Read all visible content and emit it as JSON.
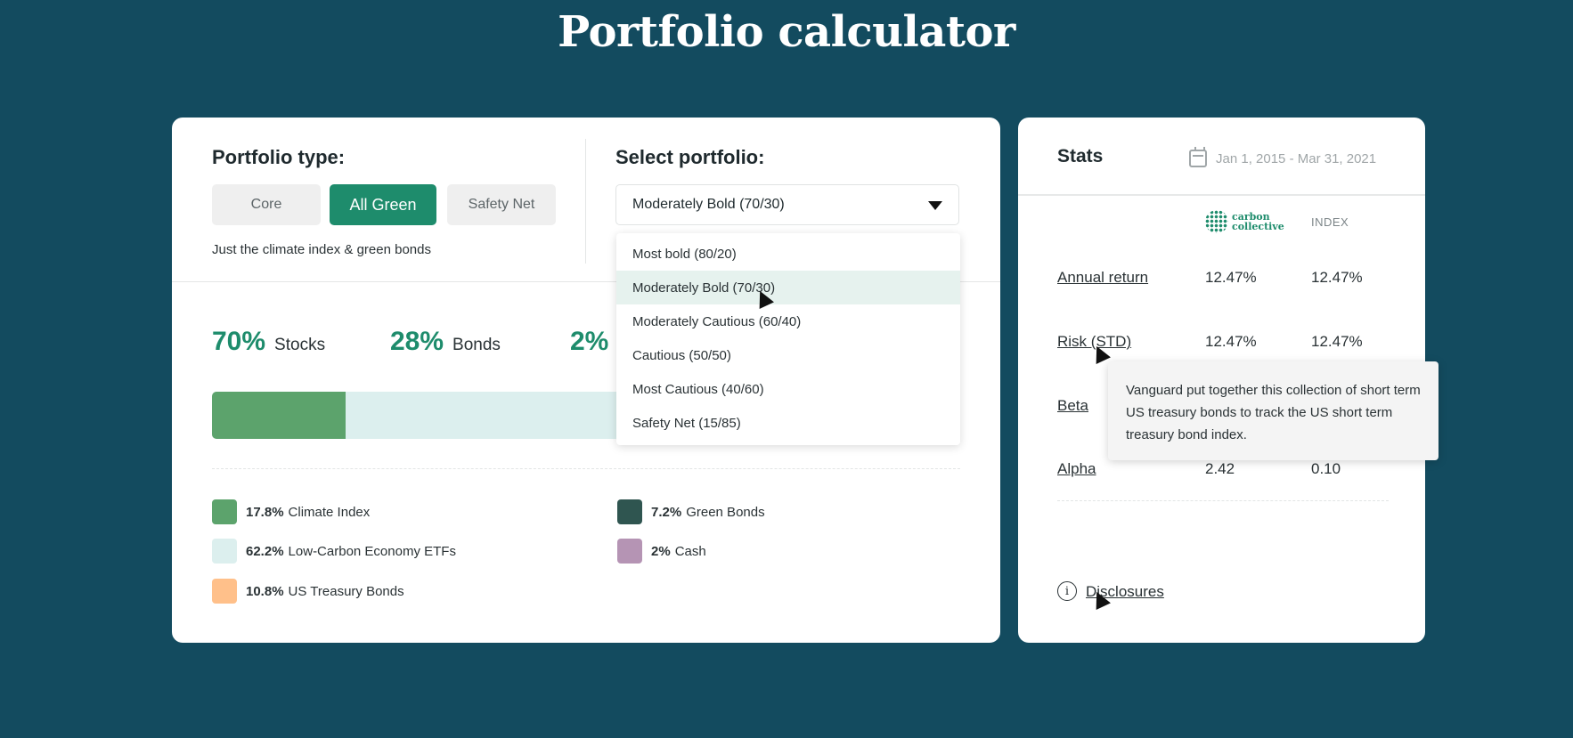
{
  "title": "Portfolio calculator",
  "portfolio_type": {
    "label": "Portfolio type:",
    "buttons": [
      {
        "label": "Core",
        "selected": false
      },
      {
        "label": "All Green",
        "selected": true
      },
      {
        "label": "Safety Net",
        "selected": false
      }
    ],
    "description": "Just the climate index & green bonds"
  },
  "select_portfolio": {
    "label": "Select portfolio:",
    "selected": "Moderately Bold (70/30)",
    "options": [
      "Most bold (80/20)",
      "Moderately Bold (70/30)",
      "Moderately Cautious (60/40)",
      "Cautious (50/50)",
      "Most Cautious (40/60)",
      "Safety Net (15/85)"
    ],
    "highlighted_option": "Moderately Bold (70/30)"
  },
  "allocation": {
    "stocks": {
      "pct": "70%",
      "label": "Stocks"
    },
    "bonds": {
      "pct": "28%",
      "label": "Bonds"
    },
    "cash": {
      "pct": "2%"
    }
  },
  "composition_bar": [
    {
      "name": "Climate Index",
      "share": 0.178,
      "color": "#5ca36c"
    },
    {
      "name": "Low-Carbon Economy ETFs",
      "share": 0.822,
      "color": "#dcefee"
    }
  ],
  "legend": [
    {
      "pct": "17.8%",
      "name": "Climate Index",
      "color": "#5ca36c"
    },
    {
      "pct": "7.2%",
      "name": "Green Bonds",
      "color": "#2f5550"
    },
    {
      "pct": "62.2%",
      "name": "Low-Carbon Economy ETFs",
      "color": "#dcefee"
    },
    {
      "pct": "2%",
      "name": "Cash",
      "color": "#b594b4"
    },
    {
      "pct": "10.8%",
      "name": "US Treasury Bonds",
      "color": "#ffc08a"
    }
  ],
  "stats": {
    "title": "Stats",
    "date_range": "Jan 1, 2015 - Mar 31, 2021",
    "brand_line1": "carbon",
    "brand_line2": "collective",
    "index_header": "INDEX",
    "rows": [
      {
        "label": "Annual return",
        "cc": "12.47%",
        "index": "12.47%"
      },
      {
        "label": "Risk (STD)",
        "cc": "12.47%",
        "index": "12.47%"
      },
      {
        "label": "Beta",
        "cc": "",
        "index": ""
      },
      {
        "label": "Alpha",
        "cc": "2.42",
        "index": "0.10"
      }
    ],
    "disclosures": "Disclosures"
  },
  "tooltip": "Vanguard put together this collection of short term US treasury bonds to track the US short term treasury bond index."
}
